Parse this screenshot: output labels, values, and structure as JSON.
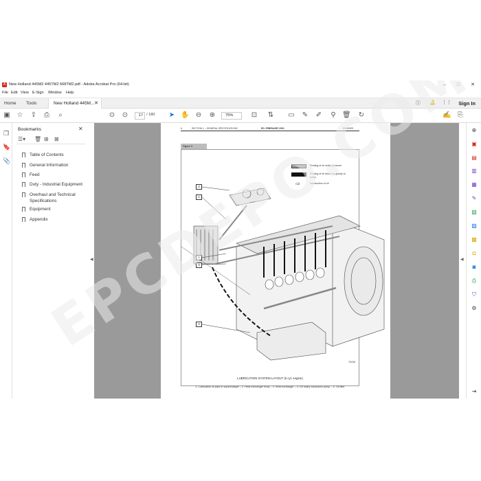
{
  "window": {
    "title": "New Holland 445M2 445TM2 668TM2.pdf - Adobe Acrobat Pro (64-bit)",
    "controls": [
      "–",
      "□",
      "✕"
    ]
  },
  "menu": [
    "File",
    "Edit",
    "View",
    "E-Sign",
    "Window",
    "Help"
  ],
  "tabs": {
    "home": "Home",
    "tools": "Tools",
    "document": "New Holland 445M...",
    "sign_in": "Sign In"
  },
  "toolbar": {
    "current_page": "17",
    "page_separator": "/",
    "total_pages": "180",
    "zoom": "75%"
  },
  "bookmarks": {
    "title": "Bookmarks",
    "items": [
      {
        "label": "Table of Contents"
      },
      {
        "label": "General Information"
      },
      {
        "label": "Feed"
      },
      {
        "label": "Duty - Industrial Equipment"
      },
      {
        "label": "Overhaul and Technical Specifications"
      },
      {
        "label": "Equipment"
      },
      {
        "label": "Appendix"
      }
    ]
  },
  "page": {
    "header_page_no": "6",
    "header_section": "SECTION 1 – GENERAL SPECIFICATIONS",
    "header_date": "ED. FEBRUARY 2001",
    "header_right": "ENGINES",
    "figure_label": "Figure 3",
    "legend": [
      {
        "text": "Routing of oil under pressure",
        "color": "#9b9b9b"
      },
      {
        "text": "Routing of oil return by gravity to sump",
        "color": "#111111"
      },
      {
        "text": "Introduction of oil"
      }
    ],
    "callouts": [
      "2",
      "1",
      "5",
      "3",
      "4"
    ],
    "figure_code": "70228",
    "caption": "LUBRICATION SYSTEM LAYOUT (6 cyl. engine)",
    "legend_caption": "1. Lubrication oil pipe to supercharger – 2. Heat exchanger body – 3. Heat exchanger – 4. Oil rotary expansion pump – 5. Oil filter"
  },
  "watermark": "EPCDEPO.COM"
}
